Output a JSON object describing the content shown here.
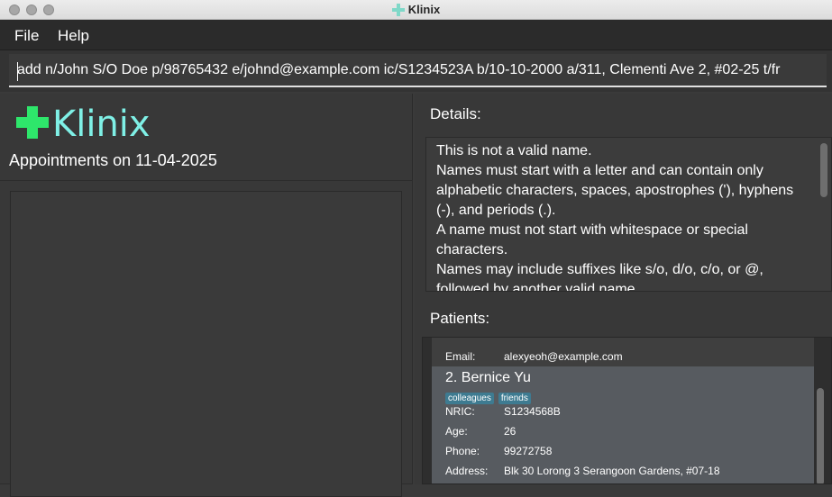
{
  "window": {
    "title": "Klinix"
  },
  "menu": {
    "items": [
      "File",
      "Help"
    ]
  },
  "command": {
    "value": "add n/John S/O Doe p/98765432 e/johnd@example.com ic/S1234523A b/10-10-2000 a/311, Clementi Ave 2, #02-25 t/fr"
  },
  "logo": {
    "text": "Klinix",
    "color_plus": "#2ee66b",
    "color_text": "#7ff0e6"
  },
  "appointments": {
    "title": "Appointments on 11-04-2025"
  },
  "details": {
    "label": "Details:",
    "lines": [
      "This is not a valid name.",
      "Names must start with a letter and can contain only",
      "alphabetic characters, spaces, apostrophes ('), hyphens",
      "(-), and periods (.).",
      "A name must not start with whitespace or special",
      "characters.",
      "Names may include suffixes like s/o, d/o, c/o, or @,",
      "followed by another valid name."
    ]
  },
  "patients": {
    "label": "Patients:",
    "previous_card": {
      "email_label": "Email:",
      "email_value": "alexyeoh@example.com"
    },
    "selected_card": {
      "name": "2. Bernice Yu",
      "tags": [
        "colleagues",
        "friends"
      ],
      "fields": [
        {
          "label": "NRIC:",
          "value": "S1234568B"
        },
        {
          "label": "Age:",
          "value": "26"
        },
        {
          "label": "Phone:",
          "value": "99272758"
        },
        {
          "label": "Address:",
          "value": "Blk 30 Lorong 3 Serangoon Gardens, #07-18"
        }
      ]
    }
  },
  "colors": {
    "background": "#3a3a3a",
    "menubar": "#2b2b2b",
    "selected_card": "#575b60",
    "tag": "#3e7b91"
  }
}
